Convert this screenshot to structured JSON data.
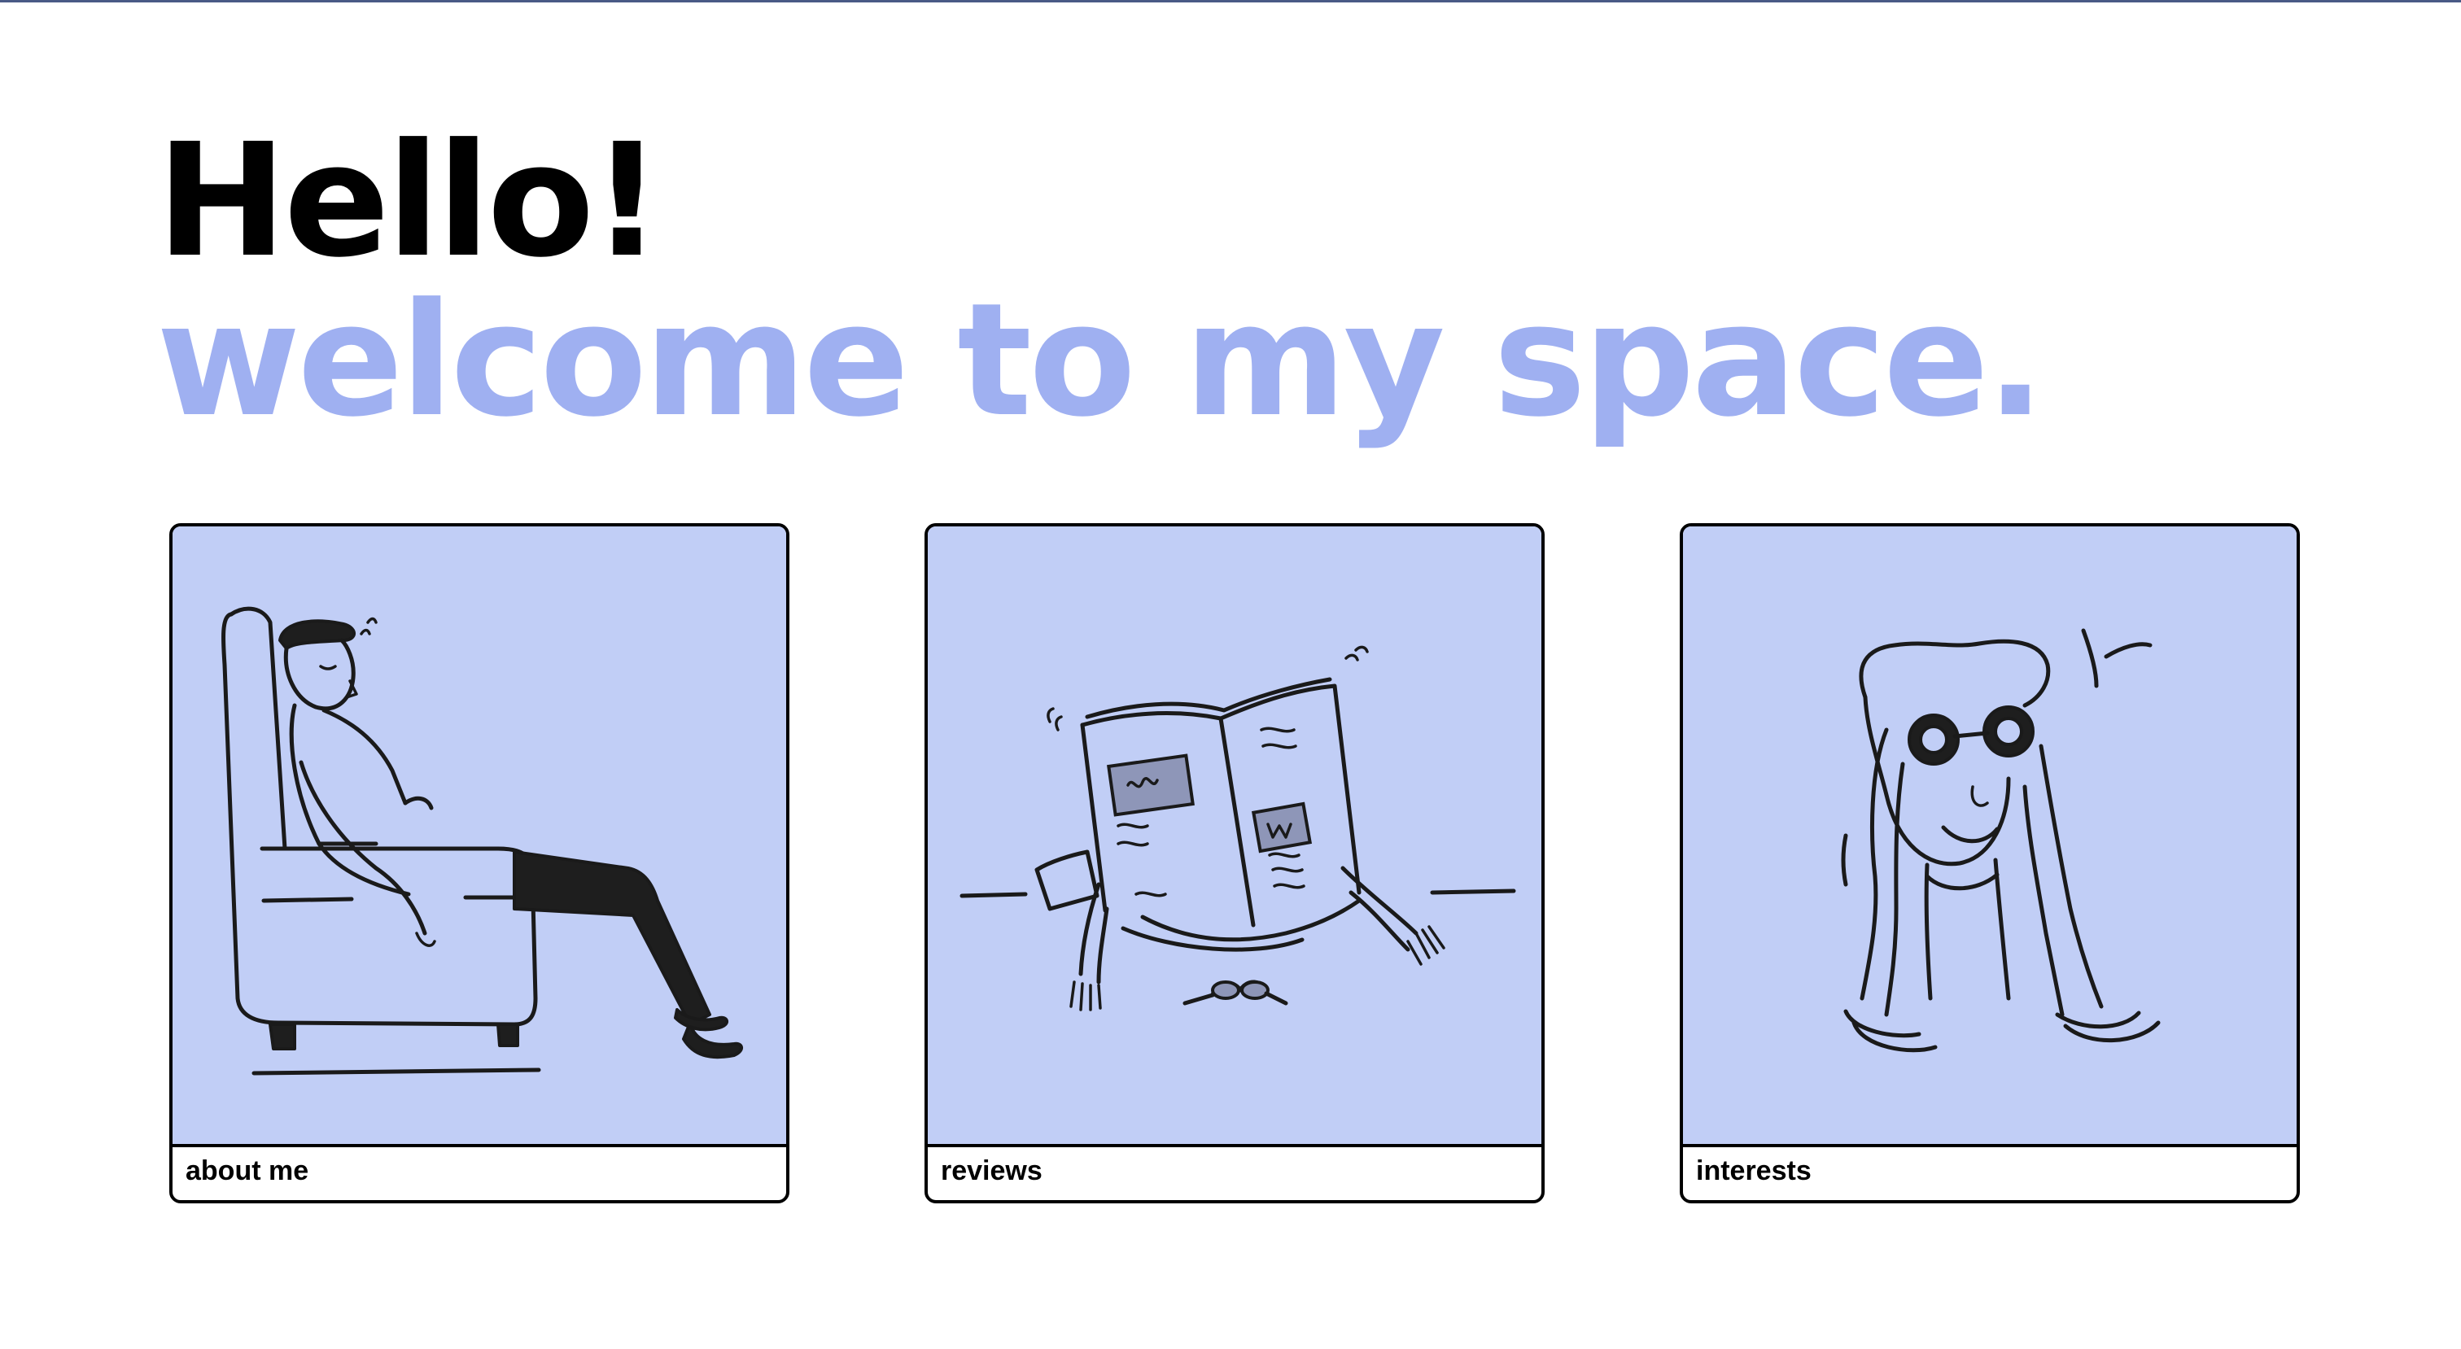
{
  "greeting": {
    "line1": "Hello!",
    "line2": "welcome to my space."
  },
  "colors": {
    "accent": "#9fb0f1",
    "card_background": "#c1cef6",
    "text": "#000000",
    "top_rule": "#4a5a86"
  },
  "cards": [
    {
      "label": "about me",
      "illustration": "person-sleeping-in-armchair"
    },
    {
      "label": "reviews",
      "illustration": "person-reading-newspaper"
    },
    {
      "label": "interests",
      "illustration": "person-with-binoculars"
    }
  ]
}
